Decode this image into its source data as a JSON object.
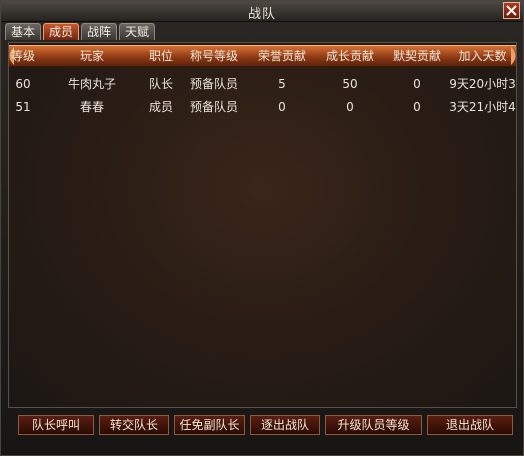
{
  "window": {
    "title": "战队"
  },
  "tabs": [
    {
      "label": "基本"
    },
    {
      "label": "成员"
    },
    {
      "label": "战阵"
    },
    {
      "label": "天赋"
    }
  ],
  "active_tab": "成员",
  "table": {
    "headers": [
      "等级",
      "玩家",
      "职位",
      "称号等级",
      "荣誉贡献",
      "成长贡献",
      "默契贡献",
      "加入天数"
    ],
    "rows": [
      [
        "60",
        "牛肉丸子",
        "队长",
        "预备队员",
        "5",
        "50",
        "0",
        "9天20小时3"
      ],
      [
        "51",
        "春春",
        "成员",
        "预备队员",
        "0",
        "0",
        "0",
        "3天21小时4"
      ]
    ]
  },
  "buttons": {
    "call": "队长呼叫",
    "transfer": "转交队长",
    "appoint": "任免副队长",
    "expel": "逐出战队",
    "upgrade": "升级队员等级",
    "quit": "退出战队"
  },
  "colors": {
    "accent": "#c7592b",
    "header": "#8a3714",
    "button": "#5a1e10"
  }
}
